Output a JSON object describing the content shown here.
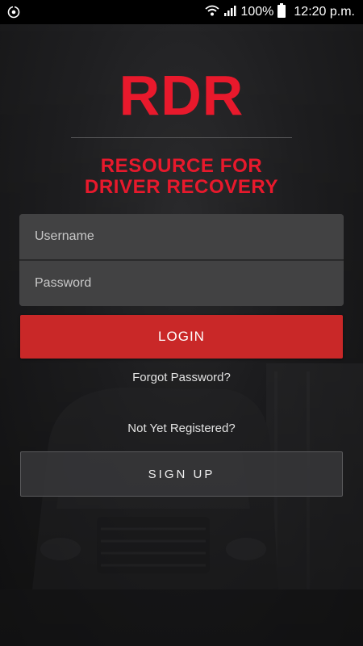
{
  "status_bar": {
    "left_icon": "sync-icon",
    "icons": [
      "wifi-icon",
      "signal-icon",
      "battery-icon"
    ],
    "battery": "100%",
    "time": "12:20 p.m."
  },
  "brand": {
    "logo": "RDR",
    "tagline_line1": "RESOURCE FOR",
    "tagline_line2": "DRIVER RECOVERY",
    "accent_color": "#e8192c"
  },
  "form": {
    "username_placeholder": "Username",
    "username_value": "",
    "password_placeholder": "Password",
    "password_value": ""
  },
  "actions": {
    "login_label": "LOGIN",
    "login_color": "#c92828",
    "forgot_password": "Forgot Password?",
    "not_registered": "Not Yet Registered?",
    "signup_label": "SIGN UP"
  }
}
